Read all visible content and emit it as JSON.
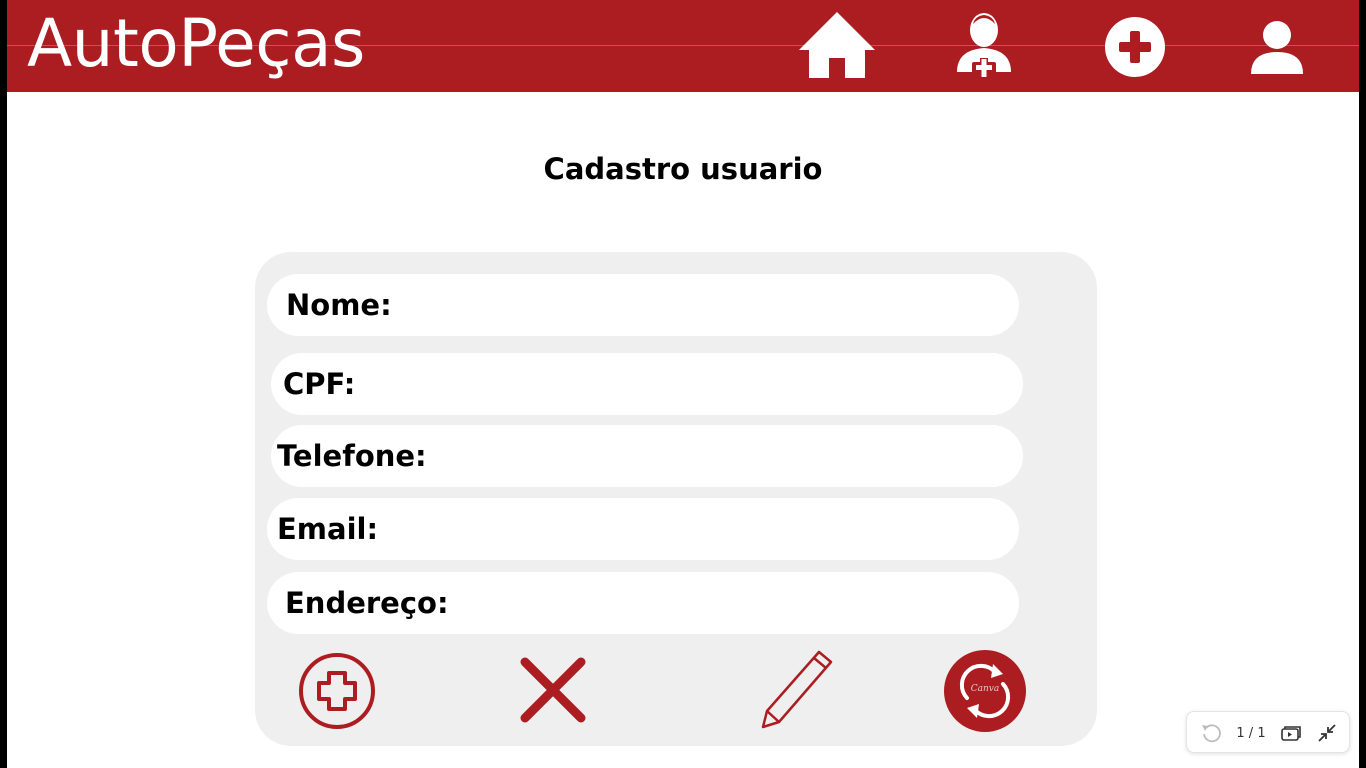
{
  "app": {
    "brand": "AutoPeças"
  },
  "nav": {
    "icons": [
      "home-icon",
      "add-user-icon",
      "plus-circle-icon",
      "user-icon"
    ]
  },
  "page": {
    "title": "Cadastro usuario"
  },
  "form": {
    "fields": [
      {
        "label": "Nome:"
      },
      {
        "label": "CPF:"
      },
      {
        "label": "Telefone:"
      },
      {
        "label": "Email:"
      },
      {
        "label": "Endereço:"
      }
    ]
  },
  "actions": {
    "icons": [
      "add-circle-icon",
      "close-icon",
      "pencil-icon",
      "refresh-icon"
    ],
    "refresh_badge": "Canva"
  },
  "viewer": {
    "page_indicator": "1 / 1"
  },
  "colors": {
    "brand_red": "#ab1d20",
    "panel_gray": "#efefef",
    "white": "#ffffff",
    "text": "#000000"
  }
}
